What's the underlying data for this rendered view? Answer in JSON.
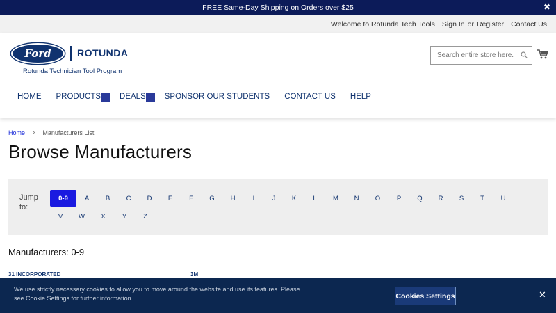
{
  "promo": {
    "text": "FREE Same-Day Shipping on Orders over $25",
    "close": "✖"
  },
  "toplinks": {
    "welcome": "Welcome to Rotunda Tech Tools",
    "signin": "Sign In",
    "or": "or",
    "register": "Register",
    "contact": "Contact Us"
  },
  "logo": {
    "ford": "Ford",
    "brand": "ROTUNDA",
    "subtitle": "Rotunda Technician Tool Program"
  },
  "search": {
    "placeholder": "Search entire store here..."
  },
  "nav": {
    "home": "HOME",
    "products": "PRODUCTS",
    "deals": "DEALS",
    "sponsor": "SPONSOR OUR STUDENTS",
    "contact": "CONTACT US",
    "help": "HELP"
  },
  "breadcrumb": {
    "home": "Home",
    "current": "Manufacturers List"
  },
  "page": {
    "title": "Browse Manufacturers"
  },
  "jump": {
    "label": "Jump to:",
    "row1": [
      "0-9",
      "A",
      "B",
      "C",
      "D",
      "E",
      "F",
      "G",
      "H",
      "I",
      "J",
      "K",
      "L",
      "M",
      "N",
      "O",
      "P",
      "Q",
      "R",
      "S",
      "T",
      "U"
    ],
    "row2": [
      "V",
      "W",
      "X",
      "Y",
      "Z"
    ],
    "active": "0-9"
  },
  "manufacturers": {
    "heading": "Manufacturers: 0-9",
    "items": [
      "31 INCORPORATED",
      "3M"
    ]
  },
  "cookie": {
    "text": "We use strictly necessary cookies to allow you to move around the website and use its features. Please see Cookie Settings for further information.",
    "button": "Cookies Settings",
    "close": "✕"
  },
  "colors": {
    "navy": "#0c1b59",
    "brand": "#10336f",
    "active": "#1a1ae0",
    "cookie_bg": "#0c2750"
  }
}
